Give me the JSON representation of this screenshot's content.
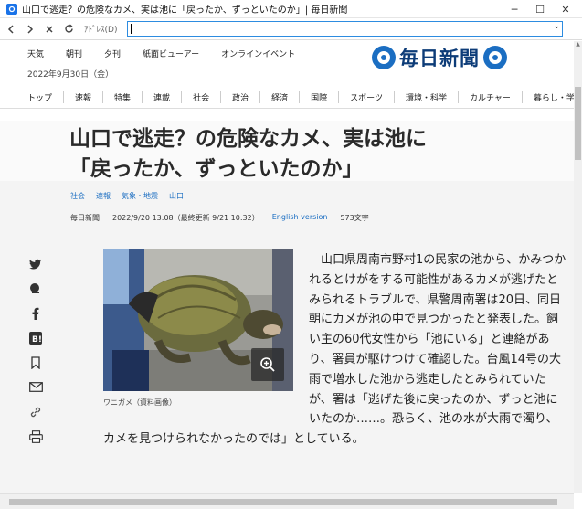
{
  "window": {
    "title": "山口で逃走？の危険なカメ、実は池に「戻ったか、ずっといたのか」| 毎日新聞",
    "minimize": "─",
    "maximize": "☐",
    "close": "✕"
  },
  "nav": {
    "address_label": "ｱﾄﾞﾚｽ(D)",
    "address_value": ""
  },
  "site": {
    "top_links": [
      "天気",
      "朝刊",
      "夕刊",
      "紙面ビューアー",
      "オンラインイベント"
    ],
    "date": "2022年9月30日（金）",
    "logo_text": "毎日新聞",
    "brand_color": "#1b6ec2",
    "categories": [
      "トップ",
      "速報",
      "特集",
      "連載",
      "社会",
      "政治",
      "経済",
      "国際",
      "スポーツ",
      "環境・科学",
      "カルチャー",
      "暮らし・学"
    ]
  },
  "article": {
    "headline_line1": "山口で逃走？の危険なカメ、実は池に",
    "headline_line2": "「戻ったか、ずっといたのか」",
    "tags": [
      "社会",
      "速報",
      "気象・地震",
      "山口"
    ],
    "source": "毎日新聞",
    "published": "2022/9/20 13:08（最終更新 9/21 10:32）",
    "english_link": "English version",
    "char_count": "573文字",
    "photo_caption": "ワニガメ（資料画像）",
    "body": "山口県周南市野村1の民家の池から、かみつかれるとけがをする可能性があるカメが逃げたとみられるトラブルで、県警周南署は20日、同日朝にカメが池の中で見つかったと発表した。飼い主の60代女性から「池にいる」と連絡があり、署員が駆けつけて確認した。台風14号の大雨で増水した池から逃走したとみられていたが、署は「逃げた後に戻ったのか、ずっと池にいたのか……。恐らく、池の水が大雨で濁り、カメを見つけられなかったのでは」としている。"
  },
  "share_icons": [
    "twitter-icon",
    "hatena-icon",
    "facebook-icon",
    "bookmark-b-icon",
    "bookmark-icon",
    "mail-icon",
    "link-icon",
    "print-icon"
  ]
}
